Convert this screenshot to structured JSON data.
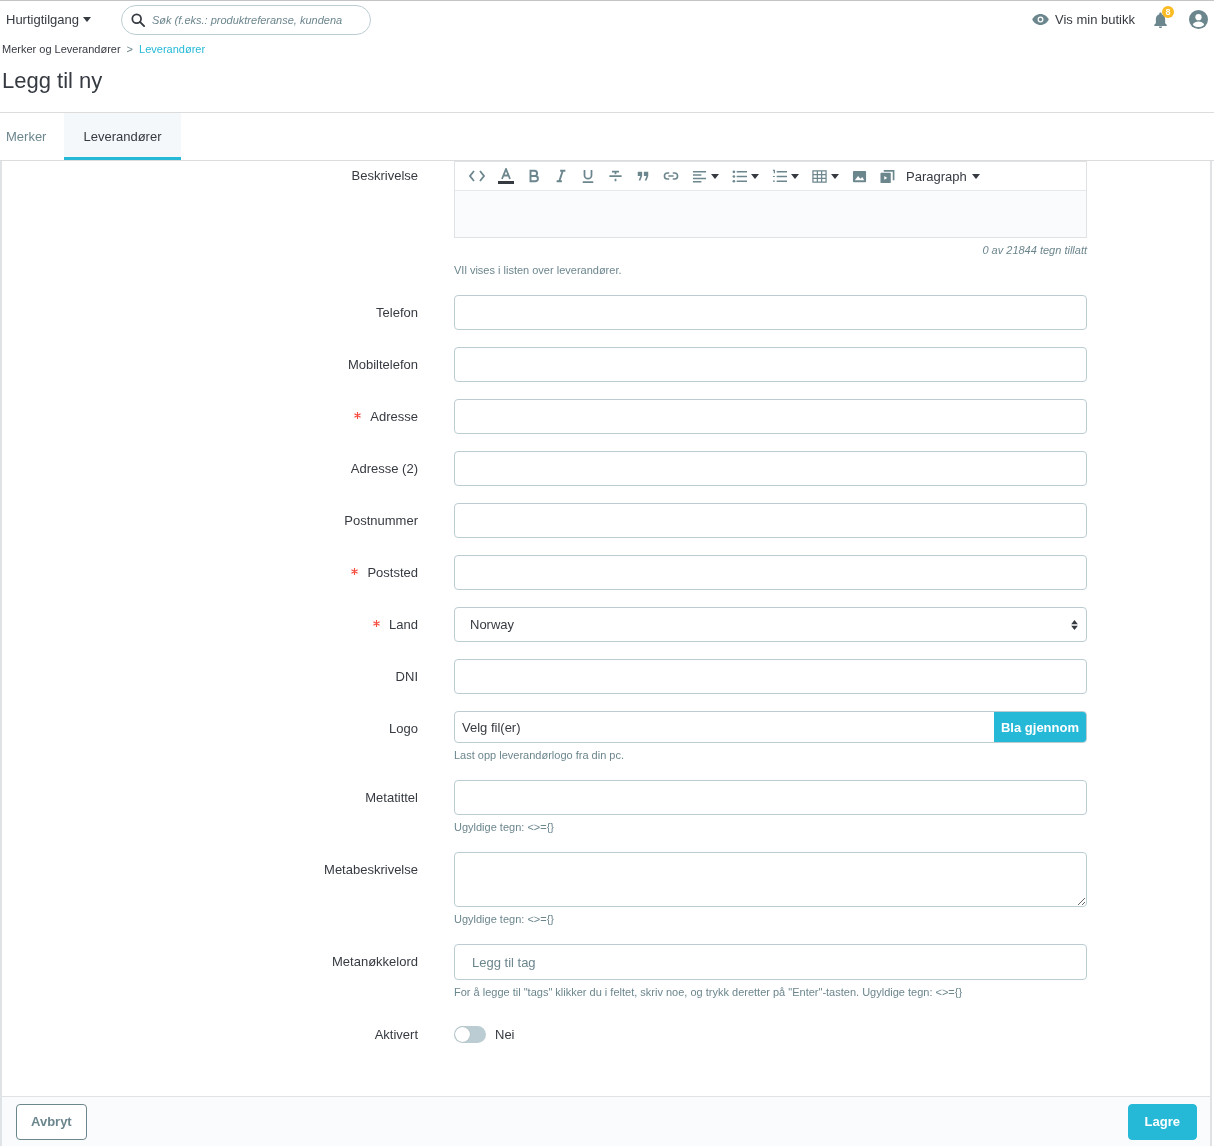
{
  "top_bar": {
    "quick_access": {
      "label": "Hurtigtilgang"
    },
    "search": {
      "placeholder": "Søk (f.eks.: produktreferanse, kundena"
    },
    "shop_link": {
      "label": "Vis min butikk"
    },
    "notifications": {
      "count": "8"
    }
  },
  "breadcrumb": {
    "separator": ">",
    "items": [
      {
        "label": "Merker og Leverandører",
        "current": false
      },
      {
        "label": "Leverandører",
        "current": true
      }
    ]
  },
  "page_title": "Legg til ny",
  "tabs": [
    {
      "label": "Merker",
      "selected": false
    },
    {
      "label": "Leverandører",
      "selected": true
    }
  ],
  "form": {
    "fields": [
      {
        "kind": "editor",
        "label": "Beskrivelse",
        "required": false,
        "format": "Paragraph",
        "counter": "0 av 21844 tegn tillatt",
        "help": "VIl vises i listen over leverandører."
      },
      {
        "kind": "text",
        "label": "Telefon",
        "required": false
      },
      {
        "kind": "text",
        "label": "Mobiltelefon",
        "required": false
      },
      {
        "kind": "text",
        "label": "Adresse",
        "required": true
      },
      {
        "kind": "text",
        "label": "Adresse (2)",
        "required": false
      },
      {
        "kind": "text",
        "label": "Postnummer",
        "required": false
      },
      {
        "kind": "text",
        "label": "Poststed",
        "required": true
      },
      {
        "kind": "select",
        "label": "Land",
        "required": true,
        "value": "Norway"
      },
      {
        "kind": "text",
        "label": "DNI",
        "required": false
      },
      {
        "kind": "file",
        "label": "Logo",
        "required": false,
        "value": "Velg fil(er)",
        "button": "Bla gjennom",
        "help": "Last opp leverandørlogo fra din pc."
      },
      {
        "kind": "text",
        "label": "Metatittel",
        "required": false,
        "help": "Ugyldige tegn: <>={}"
      },
      {
        "kind": "textarea",
        "label": "Metabeskrivelse",
        "required": false,
        "help": "Ugyldige tegn: <>={}"
      },
      {
        "kind": "tags",
        "label": "Metanøkkelord",
        "required": false,
        "placeholder": "Legg til tag",
        "help": "For å legge til \"tags\" klikker du i feltet, skriv noe, og trykk deretter på \"Enter\"-tasten. Ugyldige tegn: <>={}"
      },
      {
        "kind": "switch",
        "label": "Aktivert",
        "required": false,
        "on": false,
        "state_label": "Nei"
      }
    ]
  },
  "footer": {
    "buttons": [
      {
        "kind": "secondary",
        "label": "Avbryt"
      },
      {
        "kind": "primary",
        "label": "Lagre"
      }
    ]
  }
}
